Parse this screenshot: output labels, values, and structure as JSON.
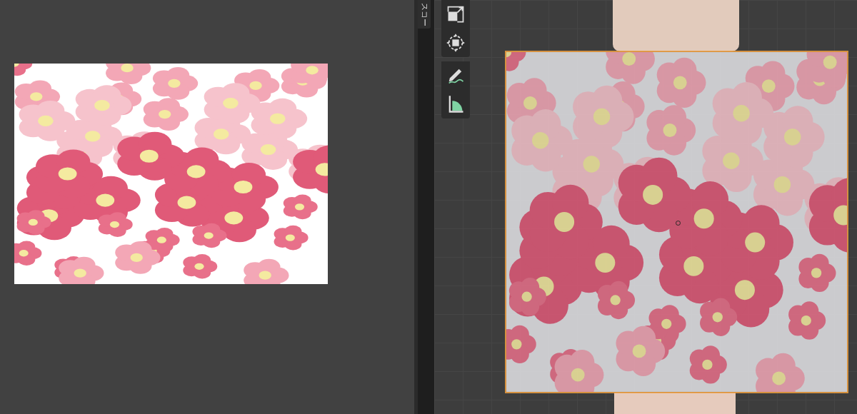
{
  "sidebar_tab": {
    "label": "スコー"
  },
  "plane": {
    "selected": true
  }
}
